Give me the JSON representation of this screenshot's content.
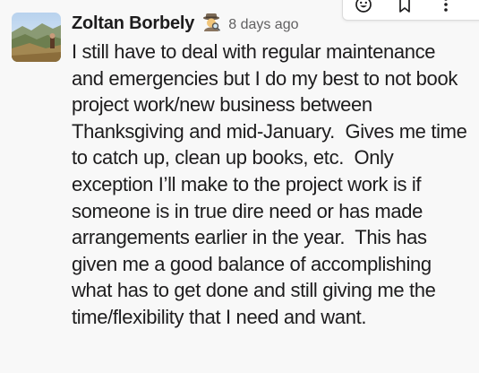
{
  "message": {
    "author": "Zoltan Borbely",
    "status_emoji": "detective-emoji",
    "timestamp": "8 days ago",
    "body": "I still have to deal with regular maintenance\nand emergencies but I do my best to not book\nproject work/new business between\nThanksgiving and mid-January.  Gives me time\nto catch up, clean up books, etc.  Only\nexception I’ll make to the project work is if\nsomeone is in true dire need or has made\narrangements earlier in the year.  This has\ngiven me a good balance of accomplishing\nwhat has to get done and still giving me the\ntime/flexibility that I need and want."
  },
  "toolbar": {
    "icons": [
      "add-reaction-icon",
      "bookmark-icon",
      "more-actions-icon"
    ]
  },
  "colors": {
    "background": "#f8f8f8",
    "text": "#1d1c1d",
    "timestamp": "#616061"
  }
}
